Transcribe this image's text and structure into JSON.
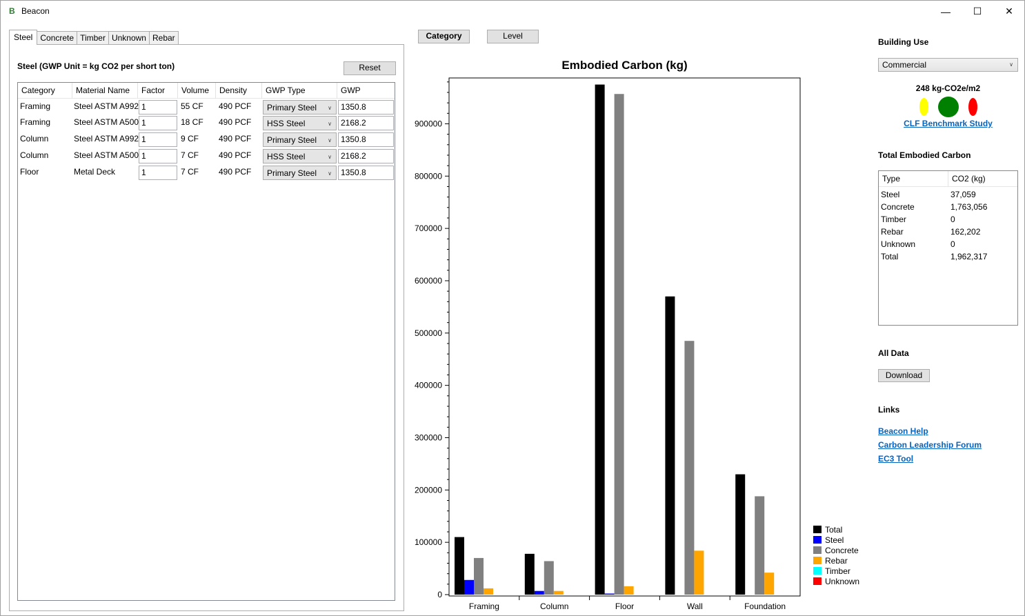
{
  "app": {
    "icon": "B",
    "title": "Beacon",
    "icon_name": "beacon-logo-icon"
  },
  "window_controls": {
    "minimize": "—",
    "maximize": "☐",
    "close": "✕"
  },
  "tabs": [
    {
      "label": "Steel",
      "active": true
    },
    {
      "label": "Concrete",
      "active": false
    },
    {
      "label": "Timber",
      "active": false
    },
    {
      "label": "Unknown",
      "active": false
    },
    {
      "label": "Rebar",
      "active": false
    }
  ],
  "steel_panel": {
    "title": "Steel (GWP Unit = kg CO2 per short ton)",
    "reset_label": "Reset",
    "columns": [
      "Category",
      "Material Name",
      "Factor",
      "Volume",
      "Density",
      "GWP Type",
      "GWP"
    ],
    "rows": [
      {
        "category": "Framing",
        "material": "Steel ASTM A992",
        "factor": "1",
        "volume": "55 CF",
        "density": "490 PCF",
        "gwp_type": "Primary Steel",
        "gwp": "1350.8"
      },
      {
        "category": "Framing",
        "material": "Steel ASTM A500",
        "factor": "1",
        "volume": "18 CF",
        "density": "490 PCF",
        "gwp_type": "HSS Steel",
        "gwp": "2168.2"
      },
      {
        "category": "Column",
        "material": "Steel ASTM A992",
        "factor": "1",
        "volume": "9 CF",
        "density": "490 PCF",
        "gwp_type": "Primary Steel",
        "gwp": "1350.8"
      },
      {
        "category": "Column",
        "material": "Steel ASTM A500",
        "factor": "1",
        "volume": "7 CF",
        "density": "490 PCF",
        "gwp_type": "HSS Steel",
        "gwp": "2168.2"
      },
      {
        "category": "Floor",
        "material": "Metal Deck",
        "factor": "1",
        "volume": "7 CF",
        "density": "490 PCF",
        "gwp_type": "Primary Steel",
        "gwp": "1350.8"
      }
    ]
  },
  "view_toggle": {
    "category_label": "Category",
    "level_label": "Level"
  },
  "chart_data": {
    "type": "bar",
    "title": "Embodied Carbon (kg)",
    "xlabel": "",
    "ylabel": "",
    "categories": [
      "Framing",
      "Column",
      "Floor",
      "Wall",
      "Foundation"
    ],
    "series": [
      {
        "name": "Total",
        "color": "#000000",
        "values": [
          110000,
          78000,
          975000,
          570000,
          230000
        ]
      },
      {
        "name": "Steel",
        "color": "#0000ff",
        "values": [
          28000,
          7000,
          2000,
          0,
          0
        ]
      },
      {
        "name": "Concrete",
        "color": "#808080",
        "values": [
          70000,
          64000,
          957000,
          485000,
          188000
        ]
      },
      {
        "name": "Rebar",
        "color": "#ffa500",
        "values": [
          12000,
          7000,
          16000,
          84000,
          42000
        ]
      },
      {
        "name": "Timber",
        "color": "#00ffff",
        "values": [
          0,
          0,
          0,
          0,
          0
        ]
      },
      {
        "name": "Unknown",
        "color": "#ff0000",
        "values": [
          0,
          0,
          0,
          0,
          0
        ]
      }
    ],
    "yticks": [
      0,
      100000,
      200000,
      300000,
      400000,
      500000,
      600000,
      700000,
      800000,
      900000
    ],
    "ylim": [
      0,
      985000
    ],
    "grid": false,
    "legend": "bottom-right"
  },
  "building_use": {
    "label": "Building Use",
    "selected": "Commercial",
    "intensity": "248 kg-CO2e/m2",
    "lights": {
      "yellow": "#ffff00",
      "green": "#008000",
      "red": "#ff0000"
    },
    "benchmark_link": "CLF Benchmark Study"
  },
  "totals": {
    "label": "Total Embodied Carbon",
    "columns": [
      "Type",
      "CO2 (kg)"
    ],
    "rows": [
      {
        "type": "Steel",
        "co2": "37,059"
      },
      {
        "type": "Concrete",
        "co2": "1,763,056"
      },
      {
        "type": "Timber",
        "co2": "0"
      },
      {
        "type": "Rebar",
        "co2": "162,202"
      },
      {
        "type": "Unknown",
        "co2": "0"
      },
      {
        "type": "Total",
        "co2": "1,962,317"
      }
    ]
  },
  "all_data": {
    "label": "All Data",
    "download_label": "Download"
  },
  "links": {
    "label": "Links",
    "items": [
      "Beacon Help",
      "Carbon Leadership Forum",
      "EC3 Tool"
    ]
  }
}
